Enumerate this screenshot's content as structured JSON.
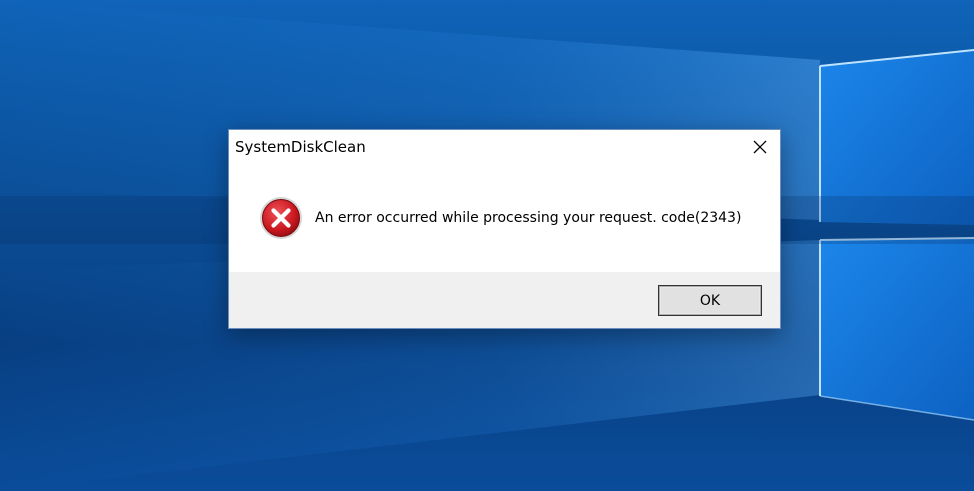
{
  "dialog": {
    "title": "SystemDiskClean",
    "message": "An error occurred while processing your request. code(2343)",
    "ok_label": "OK",
    "close_icon": "close-icon",
    "status_icon": "error-icon"
  },
  "colors": {
    "desktop_blue": "#0b4f98",
    "error_red": "#c8161d",
    "footer_gray": "#f0f0f0"
  }
}
